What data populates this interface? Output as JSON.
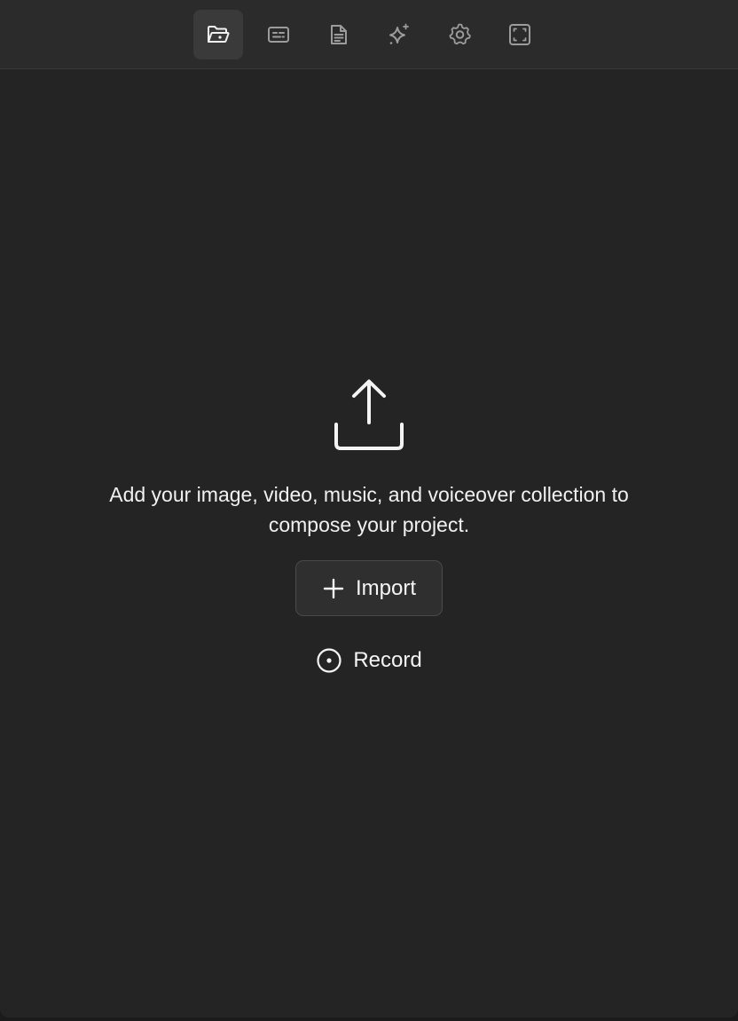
{
  "toolbar": {
    "items": [
      {
        "icon": "folder-open-icon",
        "active": true
      },
      {
        "icon": "captions-icon",
        "active": false
      },
      {
        "icon": "document-icon",
        "active": false
      },
      {
        "icon": "sparkles-icon",
        "active": false
      },
      {
        "icon": "gear-icon",
        "active": false
      },
      {
        "icon": "frame-corners-icon",
        "active": false
      }
    ]
  },
  "empty_state": {
    "icon": "upload-icon",
    "message": "Add your image, video, music, and voiceover collection to compose your project.",
    "import_label": "Import",
    "import_icon": "plus-icon",
    "record_label": "Record",
    "record_icon": "record-icon"
  },
  "colors": {
    "background": "#242424",
    "toolbar": "#2b2b2b",
    "active_tab": "#3a3a3a",
    "text": "#f1f1f1",
    "icon_inactive": "#9c9c9c"
  }
}
